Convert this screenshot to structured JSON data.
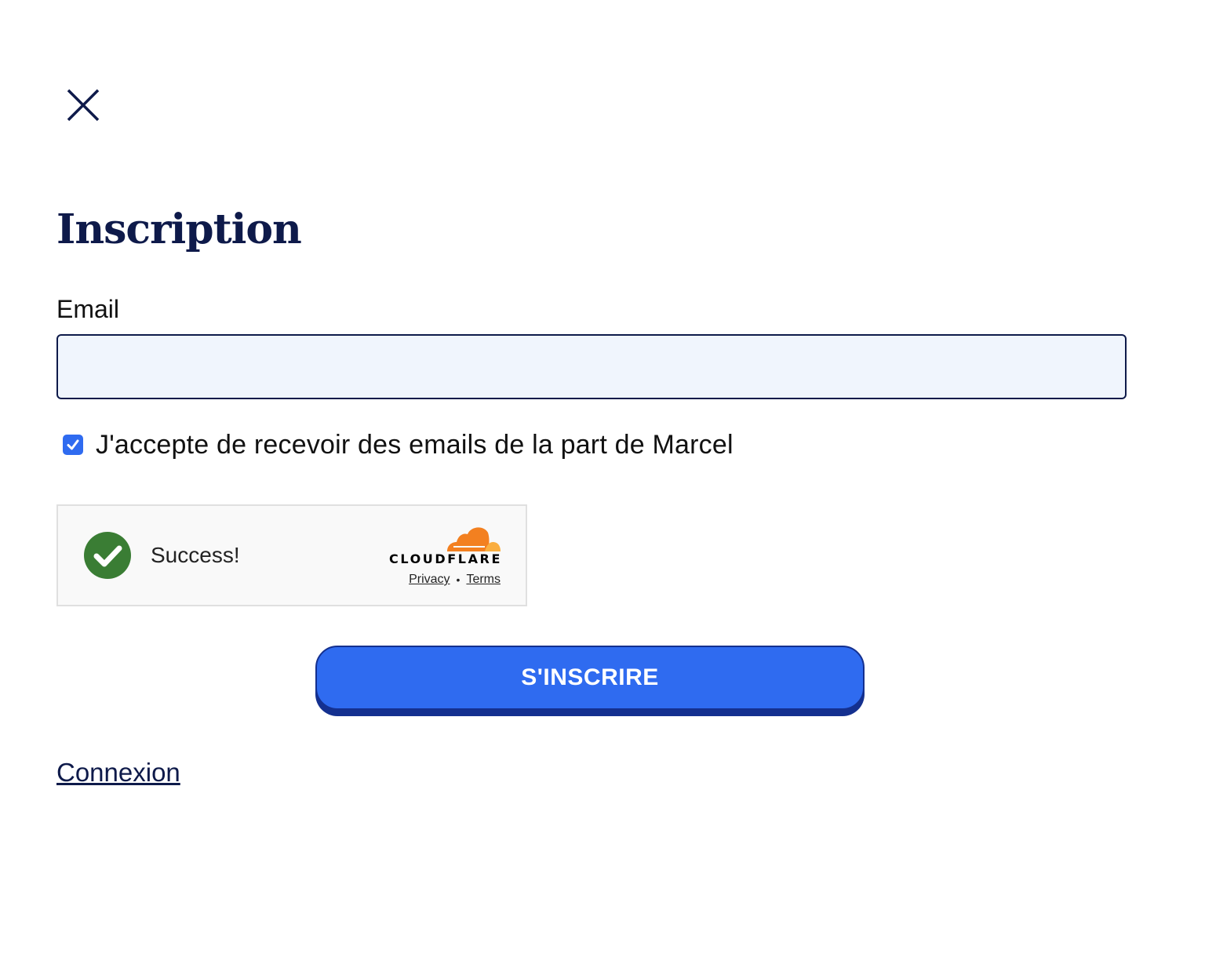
{
  "dialog": {
    "title": "Inscription"
  },
  "form": {
    "email_label": "Email",
    "email_value": "",
    "email_placeholder": "",
    "consent_label": "J'accepte de recevoir des emails de la part de Marcel",
    "consent_checked": true,
    "submit_label": "S'INSCRIRE"
  },
  "captcha": {
    "status_text": "Success!",
    "brand": "CLOUDFLARE",
    "privacy_link": "Privacy",
    "separator": "•",
    "terms_link": "Terms"
  },
  "footer": {
    "login_link": "Connexion"
  },
  "colors": {
    "primary": "#2f6bf0",
    "primary_dark": "#14308f",
    "navy": "#0e1a4a",
    "input_bg": "#f0f5fd",
    "success_green": "#3a7d34",
    "cloudflare_orange": "#f38020"
  },
  "icons": {
    "close": "close-icon",
    "checkbox": "checkmark-icon",
    "success": "success-check-icon",
    "brand": "cloudflare-logo-icon"
  }
}
